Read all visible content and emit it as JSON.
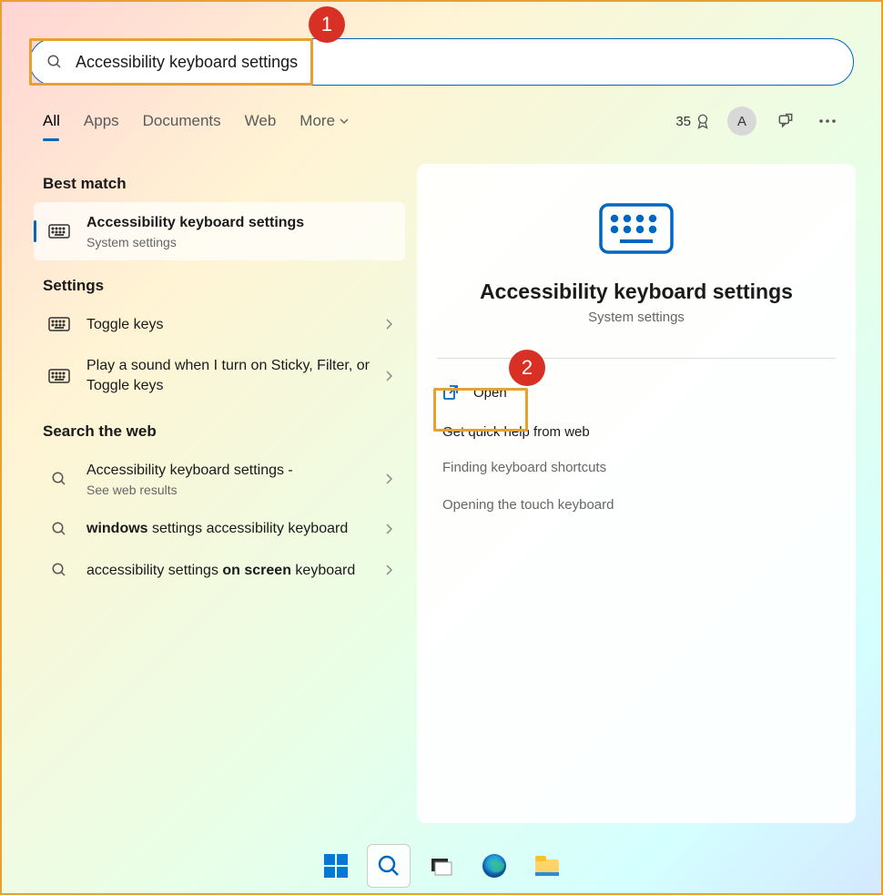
{
  "search": {
    "value": "Accessibility keyboard settings"
  },
  "callouts": {
    "one": "1",
    "two": "2"
  },
  "tabs": {
    "all": "All",
    "apps": "Apps",
    "documents": "Documents",
    "web": "Web",
    "more": "More"
  },
  "topbar": {
    "points": "35",
    "avatar": "A"
  },
  "sections": {
    "best_match": "Best match",
    "settings": "Settings",
    "search_web": "Search the web"
  },
  "best_match": {
    "title": "Accessibility keyboard settings",
    "subtitle": "System settings"
  },
  "settings_items": [
    {
      "title": "Toggle keys"
    },
    {
      "title": "Play a sound when I turn on Sticky, Filter, or Toggle keys"
    }
  ],
  "web_items": [
    {
      "prefix": "Accessibility keyboard settings",
      "suffix": " - ",
      "sub": "See web results"
    },
    {
      "bold": "windows",
      "rest": " settings accessibility keyboard"
    },
    {
      "pre": "accessibility settings ",
      "bold": "on screen",
      "post": " keyboard"
    }
  ],
  "detail": {
    "title": "Accessibility keyboard settings",
    "subtitle": "System settings",
    "open": "Open",
    "help_header": "Get quick help from web",
    "help_links": [
      "Finding keyboard shortcuts",
      "Opening the touch keyboard"
    ]
  }
}
